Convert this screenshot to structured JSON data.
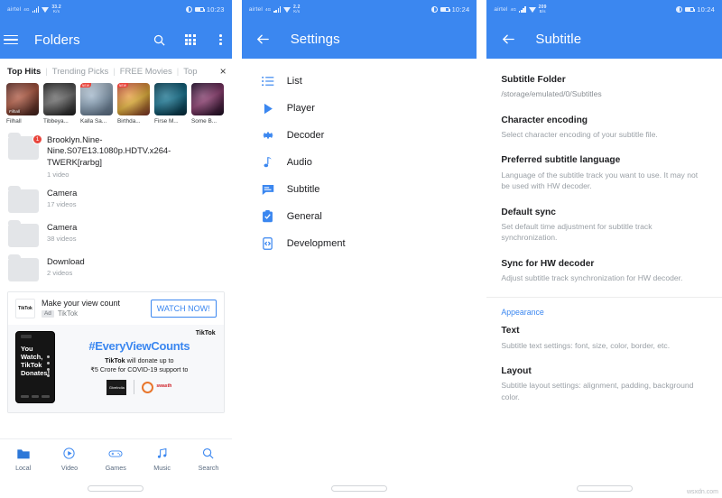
{
  "screens": {
    "folders": {
      "statusbar": {
        "carrier": "airtel",
        "network": "4G",
        "kbps_value": "33.2",
        "kbps_unit": "K/s",
        "time": "10:23",
        "battery": "54"
      },
      "appbar": {
        "title": "Folders",
        "menu_icon": "hamburger-icon",
        "search_icon": "search-icon",
        "grid_icon": "grid-view-icon",
        "overflow_icon": "more-vert-icon"
      },
      "chips": [
        {
          "label": "Top Hits",
          "active": true
        },
        {
          "label": "Trending Picks",
          "active": false
        },
        {
          "label": "FREE Movies",
          "active": false
        },
        {
          "label": "Top",
          "active": false
        }
      ],
      "chip_close": "×",
      "posters": [
        {
          "caption": "Filhall",
          "ribbon": "",
          "overlay": "Filhall"
        },
        {
          "caption": "Tibbeya...",
          "ribbon": "",
          "overlay": ""
        },
        {
          "caption": "Kalla Sa...",
          "ribbon": "NEW",
          "overlay": ""
        },
        {
          "caption": "Birthda...",
          "ribbon": "NEW",
          "overlay": ""
        },
        {
          "caption": "Firse M...",
          "ribbon": "",
          "overlay": ""
        },
        {
          "caption": "Some B...",
          "ribbon": "",
          "overlay": ""
        }
      ],
      "folders": [
        {
          "name": "Brooklyn.Nine-Nine.S07E13.1080p.HDTV.x264-TWERK[rarbg]",
          "count": "1 video",
          "badge": "1"
        },
        {
          "name": "Camera",
          "count": "17 videos",
          "badge": ""
        },
        {
          "name": "Camera",
          "count": "38 videos",
          "badge": ""
        },
        {
          "name": "Download",
          "count": "2 videos",
          "badge": ""
        }
      ],
      "ad": {
        "logo_text": "TikTok",
        "headline": "Make your view count",
        "tag": "Ad",
        "advertiser": "TikTok",
        "cta": "WATCH NOW!",
        "brand_mark": "TikTok",
        "phone_text": "You Watch, TikTok Donates!",
        "hashtag": "#EveryViewCounts",
        "line1_bold": "TikTok",
        "line1_rest": " will donate up to",
        "line2": "₹5 Crore for COVID-19 support to",
        "partner1": "GiveIndia",
        "partner2": "swasth"
      },
      "bottomnav": [
        {
          "label": "Local",
          "icon": "folder-icon"
        },
        {
          "label": "Video",
          "icon": "play-circle-icon"
        },
        {
          "label": "Games",
          "icon": "gamepad-icon"
        },
        {
          "label": "Music",
          "icon": "music-note-icon"
        },
        {
          "label": "Search",
          "icon": "search-icon"
        }
      ]
    },
    "settings": {
      "statusbar": {
        "carrier": "airtel",
        "network": "4G",
        "kbps_value": "2.2",
        "kbps_unit": "K/s",
        "time": "10:24",
        "battery": "54"
      },
      "appbar": {
        "title": "Settings",
        "back_icon": "arrow-back-icon"
      },
      "items": [
        {
          "label": "List",
          "icon": "list-icon"
        },
        {
          "label": "Player",
          "icon": "play-icon"
        },
        {
          "label": "Decoder",
          "icon": "gear-icon"
        },
        {
          "label": "Audio",
          "icon": "music-note-icon"
        },
        {
          "label": "Subtitle",
          "icon": "subtitle-icon"
        },
        {
          "label": "General",
          "icon": "clipboard-check-icon"
        },
        {
          "label": "Development",
          "icon": "developer-mode-icon"
        }
      ]
    },
    "subtitle": {
      "statusbar": {
        "carrier": "airtel",
        "network": "4G",
        "kbps_value": "209",
        "kbps_unit": "B/s",
        "time": "10:24",
        "battery": "54"
      },
      "appbar": {
        "title": "Subtitle",
        "back_icon": "arrow-back-icon"
      },
      "prefs": [
        {
          "title": "Subtitle Folder",
          "desc": "/storage/emulated/0/Subtitles"
        },
        {
          "title": "Character encoding",
          "desc": "Select character encoding of your subtitle file."
        },
        {
          "title": "Preferred subtitle language",
          "desc": "Language of the subtitle track you want to use. It may not be used with HW decoder."
        },
        {
          "title": "Default sync",
          "desc": "Set default time adjustment for subtitle track synchronization."
        },
        {
          "title": "Sync for HW decoder",
          "desc": "Adjust subtitle track synchronization for HW decoder."
        }
      ],
      "category": "Appearance",
      "appearance_prefs": [
        {
          "title": "Text",
          "desc": "Subtitle text settings: font, size, color, border, etc."
        },
        {
          "title": "Layout",
          "desc": "Subtitle layout settings: alignment, padding, background color."
        }
      ],
      "watermark": "wsxdn.com"
    }
  },
  "colors": {
    "accent": "#3b87f0",
    "badge": "#e8453c",
    "text_primary": "#202124",
    "text_secondary": "#9aa0a6"
  }
}
